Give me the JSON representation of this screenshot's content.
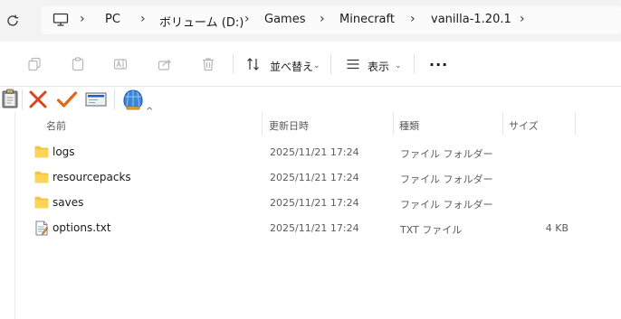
{
  "address": {
    "refresh_icon": "refresh-icon",
    "crumbs": [
      "PC",
      "ボリューム (D:)",
      "Games",
      "Minecraft",
      "vanilla-1.20.1"
    ]
  },
  "command_bar": {
    "icons": [
      "copy-icon",
      "paste-icon",
      "rename-icon",
      "share-icon",
      "delete-icon"
    ],
    "sort_label": "並べ替え",
    "view_label": "表示",
    "more_label": "..."
  },
  "plugin_toolbar": {
    "icons": [
      "clipboard-icon",
      "close-x-icon",
      "checkmark-icon",
      "envelope-icon",
      "shell-icon"
    ]
  },
  "columns": {
    "name": "名前",
    "modified": "更新日時",
    "type": "種類",
    "size": "サイズ"
  },
  "files": [
    {
      "name": "logs",
      "modified": "2025/11/21 17:24",
      "type": "ファイル フォルダー",
      "size": "",
      "icon": "folder-icon"
    },
    {
      "name": "resourcepacks",
      "modified": "2025/11/21 17:24",
      "type": "ファイル フォルダー",
      "size": "",
      "icon": "folder-icon"
    },
    {
      "name": "saves",
      "modified": "2025/11/21 17:24",
      "type": "ファイル フォルダー",
      "size": "",
      "icon": "folder-icon"
    },
    {
      "name": "options.txt",
      "modified": "2025/11/21 17:24",
      "type": "TXT ファイル",
      "size": "4 KB",
      "icon": "text-file-icon"
    }
  ],
  "colors": {
    "accent": "#0067c0",
    "folder": "#f4c33f",
    "red_x": "#d9461e",
    "check": "#de6a1a"
  }
}
